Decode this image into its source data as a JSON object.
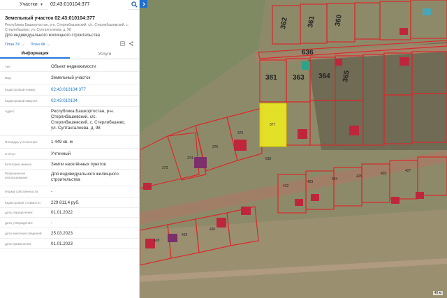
{
  "search": {
    "type_label": "Участки",
    "query": "02:43:010104:377"
  },
  "object": {
    "title": "Земельный участок 02:43:010104:377",
    "address_short": "Республика Башкортостан, р-н. Стерлибашевский, с/с. Стерлибашевский, с. Стерлибашево, ул. Султангалеева, д. 98",
    "purpose_short": "Для индивидуального жилищного строительства"
  },
  "links": {
    "plan_zu": "План ЗУ →",
    "plan_kk": "План КК →"
  },
  "tabs": [
    {
      "label": "Информация",
      "active": true
    },
    {
      "label": "Услуги",
      "active": false
    }
  ],
  "info": [
    {
      "label": "Тип:",
      "value": "Объект недвижимости",
      "link": false
    },
    {
      "label": "Вид:",
      "value": "Земельный участок",
      "link": false
    },
    {
      "label": "Кадастровый номер:",
      "value": "02:43:010104:377",
      "link": true
    },
    {
      "label": "Кадастровый квартал:",
      "value": "02:43:010104",
      "link": true
    },
    {
      "label": "Адрес:",
      "value": "Республика Башкортостан, р-н. Стерлибашевский, с/с. Стерлибашевский, с. Стерлибашево, ул. Султангалеева, д. 98",
      "link": false
    },
    {
      "label": "Площадь уточненная:",
      "value": "1 449 кв. м",
      "link": false
    },
    {
      "label": "Статус:",
      "value": "Учтенный",
      "link": false
    },
    {
      "label": "Категория земель:",
      "value": "Земли населённых пунктов",
      "link": false
    },
    {
      "label": "Разрешенное использование:",
      "value": "Для индивидуального жилищного строительства",
      "link": false
    },
    {
      "label": "Форма собственности:",
      "value": "-",
      "link": false
    },
    {
      "label": "Кадастровая стоимость:",
      "value": "229 811,4 руб.",
      "link": false
    },
    {
      "label": "дата определения:",
      "value": "01.01.2022",
      "link": false
    },
    {
      "label": "дата утверждения:",
      "value": "-",
      "link": false
    },
    {
      "label": "дата внесения сведений:",
      "value": "25.03.2023",
      "link": false
    },
    {
      "label": "дата применения:",
      "value": "01.01.2023",
      "link": false
    }
  ],
  "map": {
    "parcel_labels": [
      "362",
      "361",
      "360",
      "636",
      "381",
      "363",
      "364",
      "365",
      "377",
      "376",
      "375",
      "374",
      "373",
      "636",
      "422",
      "423",
      "424",
      "425",
      "426",
      "427",
      "428",
      "429",
      "430"
    ],
    "scale_label": "40 м",
    "highlight_color": "#f2ee1c",
    "boundary_color": "#d92a2a"
  }
}
